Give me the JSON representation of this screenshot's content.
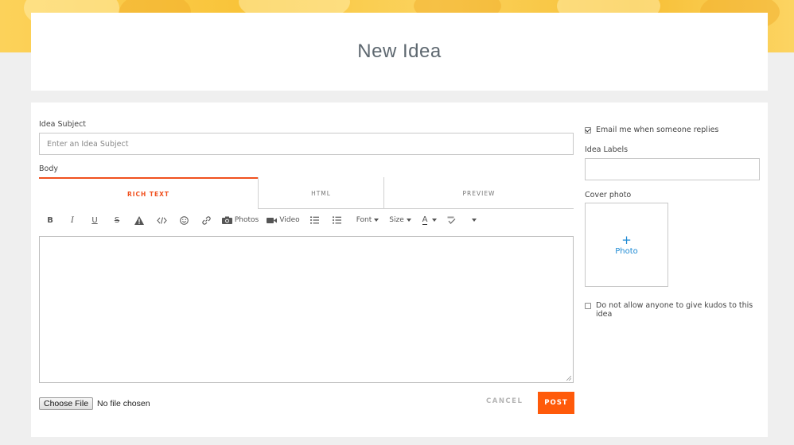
{
  "page": {
    "title": "New Idea"
  },
  "form": {
    "subject_label": "Idea Subject",
    "subject_placeholder": "Enter an Idea Subject",
    "body_label": "Body",
    "tabs": [
      "RICH TEXT",
      "HTML",
      "PREVIEW"
    ],
    "active_tab": "RICH TEXT",
    "toolbar": {
      "bold": "B",
      "italic": "I",
      "underline": "U",
      "strike": "S",
      "photos": "Photos",
      "video": "Video",
      "font": "Font",
      "size": "Size",
      "text_color": "A"
    },
    "file": {
      "button": "Choose File",
      "status": "No file chosen"
    },
    "cancel": "CANCEL",
    "post": "POST"
  },
  "side": {
    "email_label": "Email me when someone replies",
    "email_checked": true,
    "labels_label": "Idea Labels",
    "cover_label": "Cover photo",
    "cover_plus": "+",
    "cover_button": "Photo",
    "kudos_label": "Do not allow anyone to give kudos to this idea",
    "kudos_checked": false
  },
  "colors": {
    "accent": "#f0501e",
    "post_button": "#ff5a0a",
    "link": "#1d8ad4",
    "banner": "#f9c43a"
  }
}
